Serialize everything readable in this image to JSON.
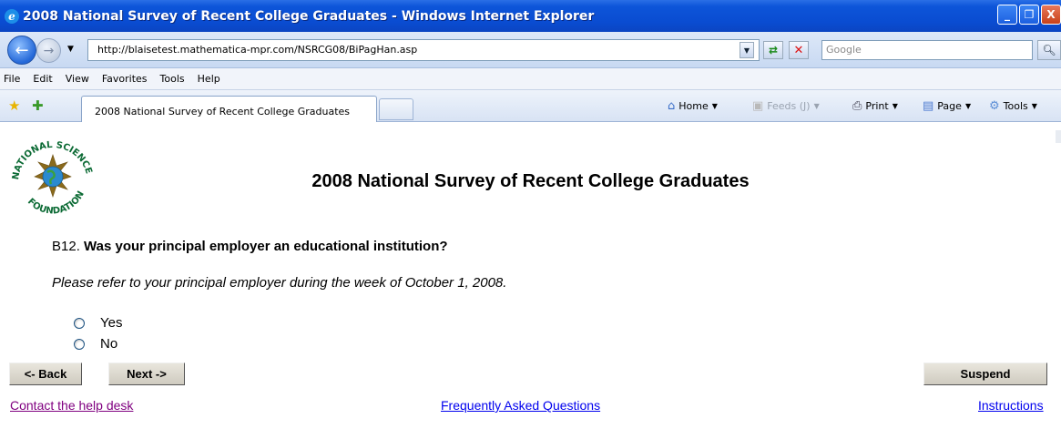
{
  "window": {
    "title": "2008 National Survey of Recent College Graduates - Windows Internet Explorer",
    "minimize": "_",
    "maximize": "❐",
    "close": "X"
  },
  "browser": {
    "url": "http://blaisetest.mathematica-mpr.com/NSRCG08/BiPagHan.asp",
    "search_placeholder": "Google",
    "menu": [
      "File",
      "Edit",
      "View",
      "Favorites",
      "Tools",
      "Help"
    ],
    "tab_title": "2008 National Survey of Recent College Graduates",
    "commands": {
      "home": "Home",
      "feeds": "Feeds (J)",
      "print": "Print",
      "page": "Page",
      "tools": "Tools"
    },
    "icons": {
      "back": "back-arrow-icon",
      "forward": "forward-arrow-icon",
      "refresh": "refresh-icon",
      "stop": "stop-icon",
      "search": "search-icon",
      "favorites": "star-icon",
      "add_favorite": "add-favorite-icon"
    }
  },
  "survey": {
    "title": "2008 National Survey of Recent College Graduates",
    "logo_text_top": "NATIONAL SCIENCE",
    "logo_text_bottom": "FOUNDATION",
    "question_number": "B12.",
    "question_text": "Was your principal employer an educational institution?",
    "instruction": "Please refer to your principal employer during the week of October 1, 2008.",
    "options": [
      "Yes",
      "No"
    ],
    "buttons": {
      "back": "<- Back",
      "next": "Next ->",
      "suspend": "Suspend"
    },
    "links": {
      "help_desk": "Contact the help desk",
      "faq": "Frequently Asked Questions",
      "instructions": "Instructions"
    }
  },
  "colors": {
    "titlebar": "#0a4cd1",
    "link": "#0000ee",
    "visited_link": "#800080",
    "button_face": "#d8d4c8"
  }
}
